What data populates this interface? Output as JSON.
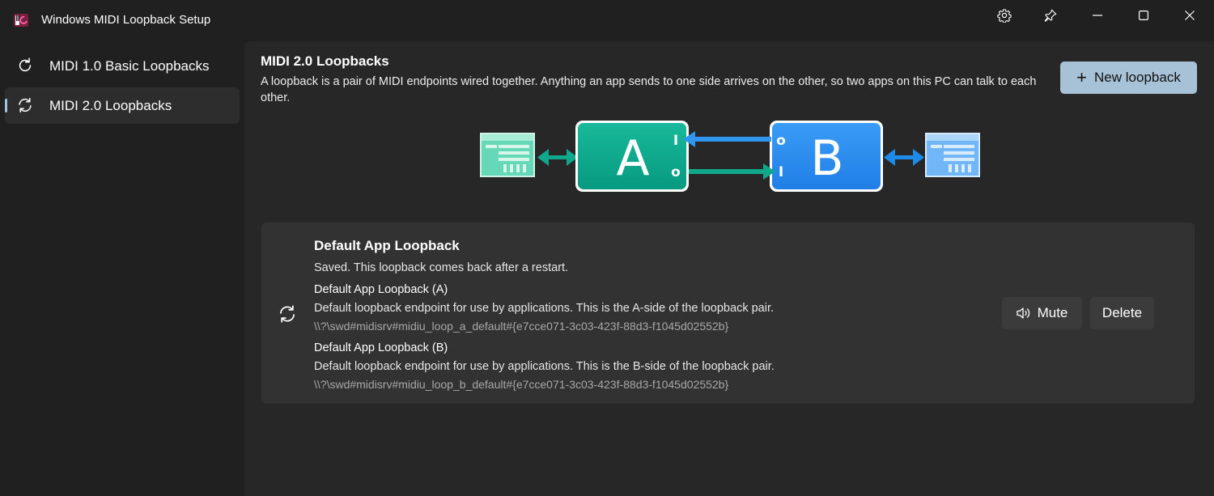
{
  "window": {
    "title": "Windows MIDI Loopback Setup",
    "controls": [
      "settings",
      "pin",
      "minimize",
      "maximize",
      "close"
    ]
  },
  "sidebar": {
    "items": [
      {
        "label": "MIDI 1.0 Basic Loopbacks",
        "icon": "refresh-icon",
        "selected": false
      },
      {
        "label": "MIDI 2.0 Loopbacks",
        "icon": "sync-icon",
        "selected": true
      }
    ]
  },
  "main": {
    "title": "MIDI 2.0 Loopbacks",
    "description": "A loopback is a pair of MIDI endpoints wired together. Anything an app sends to one side arrives on the other, so two apps on this PC can talk to each other.",
    "new_button": {
      "icon": "plus-icon",
      "label": "New loopback"
    },
    "diagram": {
      "side_a": "A",
      "side_b": "B",
      "a_in": "I",
      "a_out": "o",
      "b_out": "o",
      "b_in": "I",
      "colors": {
        "a": "#0ea98d",
        "b": "#2a8df0",
        "app_a": "#5fd6b3",
        "app_b": "#6cb7f5"
      }
    },
    "card": {
      "icon": "sync-icon",
      "title": "Default App Loopback",
      "status": "Saved. This loopback comes back after a restart.",
      "endpoints": [
        {
          "name": "Default App Loopback (A)",
          "description": "Default loopback endpoint for use by applications. This is the A-side of the loopback pair.",
          "id": "\\\\?\\swd#midisrv#midiu_loop_a_default#{e7cce071-3c03-423f-88d3-f1045d02552b}"
        },
        {
          "name": "Default App Loopback (B)",
          "description": "Default loopback endpoint for use by applications. This is the B-side of the loopback pair.",
          "id": "\\\\?\\swd#midisrv#midiu_loop_b_default#{e7cce071-3c03-423f-88d3-f1045d02552b}"
        }
      ],
      "mute_label": "Mute",
      "delete_label": "Delete"
    }
  },
  "colors": {
    "window_bg": "#202020",
    "panel_bg": "#272727",
    "card_bg": "#323232",
    "accent_button": "#a7c2d6"
  }
}
